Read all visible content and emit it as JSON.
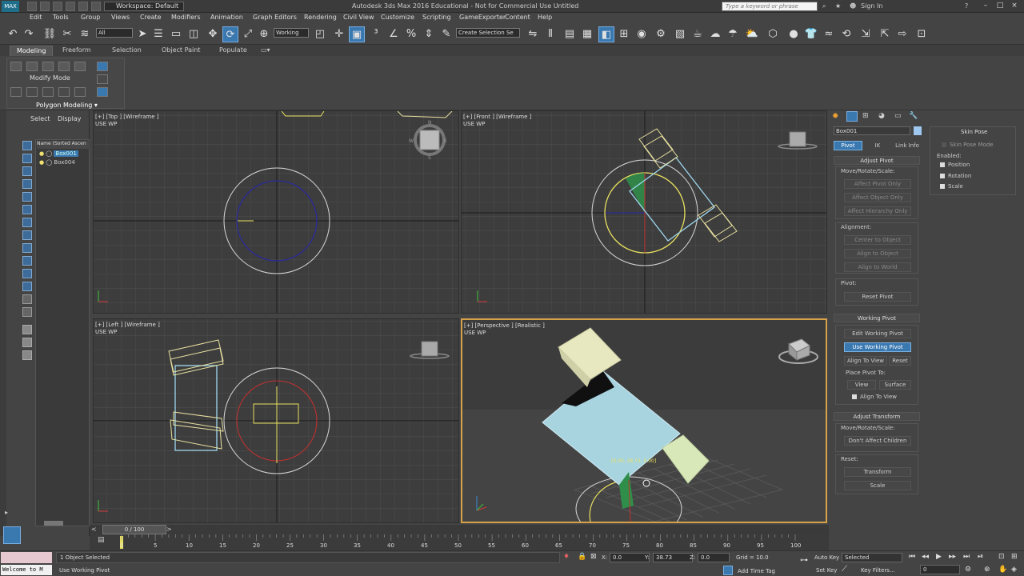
{
  "titlebar": {
    "logo": "MAX",
    "workspace": "Workspace: Default",
    "title": "Autodesk 3ds Max 2016 Educational - Not for Commercial Use   Untitled",
    "search_placeholder": "Type a keyword or phrase",
    "signin": "Sign In",
    "minimize": "–",
    "maximize": "□",
    "close": "×"
  },
  "menu": [
    "Edit",
    "Tools",
    "Group",
    "Views",
    "Create",
    "Modifiers",
    "Animation",
    "Graph Editors",
    "Rendering",
    "Civil View",
    "Customize",
    "Scripting",
    "GameExporter",
    "Content",
    "Help"
  ],
  "toolbar": {
    "selection_filter": "All",
    "reference_coord": "Working",
    "named_selection": "Create Selection Se"
  },
  "ribbon": {
    "tabs": [
      "Modeling",
      "Freeform",
      "Selection",
      "Object Paint",
      "Populate"
    ],
    "modify_mode": "Modify Mode",
    "polygon_modeling": "Polygon Modeling"
  },
  "explorer": {
    "tabs": [
      "Select",
      "Display"
    ],
    "column_header": "Name (Sorted Ascen",
    "items": [
      "Box001",
      "Box004"
    ]
  },
  "viewports": {
    "top": "[+] [Top ] [Wireframe ]\nUSE WP",
    "front": "[+] [Front ] [Wireframe ]\nUSE WP",
    "left": "[+] [Left ] [Wireframe ]\nUSE WP",
    "perspective": "[+] [Perspective ] [Realistic ]\nUSE WP",
    "persp_readout": "[0.00, 38.73, 0.00]"
  },
  "command_panel": {
    "object_name": "Box001",
    "tabs": [
      "Pivot",
      "IK",
      "Link Info"
    ],
    "adjust_pivot": {
      "title": "Adjust Pivot",
      "move_label": "Move/Rotate/Scale:",
      "buttons": [
        "Affect Pivot Only",
        "Affect Object Only",
        "Affect Hierarchy Only"
      ],
      "alignment_label": "Alignment:",
      "align_buttons": [
        "Center to Object",
        "Align to Object",
        "Align to World"
      ],
      "pivot_label": "Pivot:",
      "reset_pivot": "Reset Pivot"
    },
    "working_pivot": {
      "title": "Working Pivot",
      "edit": "Edit Working Pivot",
      "use": "Use Working Pivot",
      "align_to_view": "Align To View",
      "reset": "Reset",
      "place_pivot_to": "Place Pivot To:",
      "view": "View",
      "surface": "Surface",
      "align_check": "Align To View"
    },
    "adjust_transform": {
      "title": "Adjust Transform",
      "move_label": "Move/Rotate/Scale:",
      "dont_affect": "Don't Affect Children",
      "reset_label": "Reset:",
      "transform": "Transform",
      "scale": "Scale"
    }
  },
  "skin_pose": {
    "title": "Skin Pose",
    "skin_pose_mode": "Skin Pose Mode",
    "enabled": "Enabled:",
    "position": "Position",
    "rotation": "Rotation",
    "scale": "Scale"
  },
  "timeline": {
    "frame_display": "0 / 100",
    "current_frame": 0,
    "total_frames": 100,
    "ticks": [
      "0",
      "5",
      "10",
      "15",
      "20",
      "25",
      "30",
      "35",
      "40",
      "45",
      "50",
      "55",
      "60",
      "65",
      "70",
      "75",
      "80",
      "85",
      "90",
      "95",
      "100"
    ]
  },
  "status": {
    "maxscript": "Welcome to M",
    "selected": "1 Object Selected",
    "prompt": "Use Working Pivot",
    "x_label": "X:",
    "x_value": "0.0",
    "y_label": "Y:",
    "y_value": "38.73",
    "z_label": "Z:",
    "z_value": "0.0",
    "grid": "Grid = 10.0",
    "add_time_tag": "Add Time Tag",
    "auto_key": "Auto Key",
    "set_key": "Set Key",
    "selected_dd": "Selected",
    "key_filters": "Key Filters...",
    "frame_field": "0"
  },
  "colors": {
    "selection_blue": "#3a78b0",
    "wire_yellow": "#e8e060",
    "wire_blue": "#9fd8f0",
    "box_pale": "#e8e8c0",
    "box_blue": "#a8d4e0"
  }
}
